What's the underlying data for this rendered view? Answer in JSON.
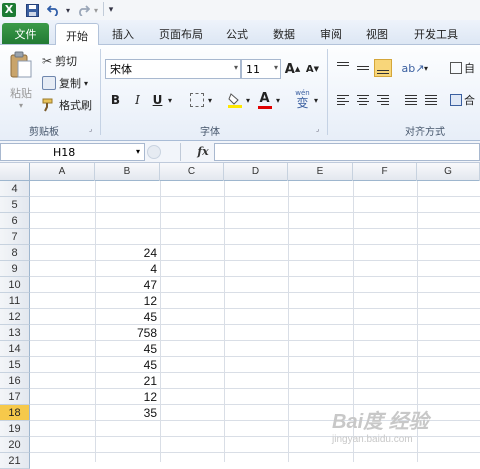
{
  "app": {
    "logo_letter": "X"
  },
  "quick_access": {
    "dropdown_label": "▾"
  },
  "tabs": [
    {
      "label": "文件"
    },
    {
      "label": "开始"
    },
    {
      "label": "插入"
    },
    {
      "label": "页面布局"
    },
    {
      "label": "公式"
    },
    {
      "label": "数据"
    },
    {
      "label": "审阅"
    },
    {
      "label": "视图"
    },
    {
      "label": "开发工具"
    }
  ],
  "clipboard": {
    "paste_label": "粘贴",
    "cut_label": "剪切",
    "copy_label": "复制",
    "format_painter_label": "格式刷",
    "group_label": "剪贴板"
  },
  "font": {
    "font_name": "宋体",
    "font_size": "11",
    "grow_label": "A",
    "shrink_label": "A",
    "bold": "B",
    "italic": "I",
    "underline": "U",
    "font_color_label": "A",
    "phonetic_label": "变",
    "group_label": "字体"
  },
  "alignment": {
    "group_label": "对齐方式",
    "wrap_label": "自",
    "merge_label": "合"
  },
  "formula_bar": {
    "name_box": "H18",
    "fx_label": "fx",
    "formula": ""
  },
  "columns": [
    "A",
    "B",
    "C",
    "D",
    "E",
    "F",
    "G"
  ],
  "rows": [
    "4",
    "5",
    "6",
    "7",
    "8",
    "9",
    "10",
    "11",
    "12",
    "13",
    "14",
    "15",
    "16",
    "17",
    "18",
    "19",
    "20",
    "21"
  ],
  "values_col_b": [
    "",
    "",
    "",
    "",
    "24",
    "4",
    "47",
    "12",
    "45",
    "758",
    "45",
    "45",
    "21",
    "12",
    "35",
    "",
    "",
    ""
  ],
  "selected_row": "18",
  "watermark": {
    "text": "Bai度 经验",
    "sub": "jingyan.baidu.com"
  },
  "colors": {
    "file_tab": "#217a34",
    "selected_header": "#f6c94b",
    "accent": "#1e7b34"
  }
}
